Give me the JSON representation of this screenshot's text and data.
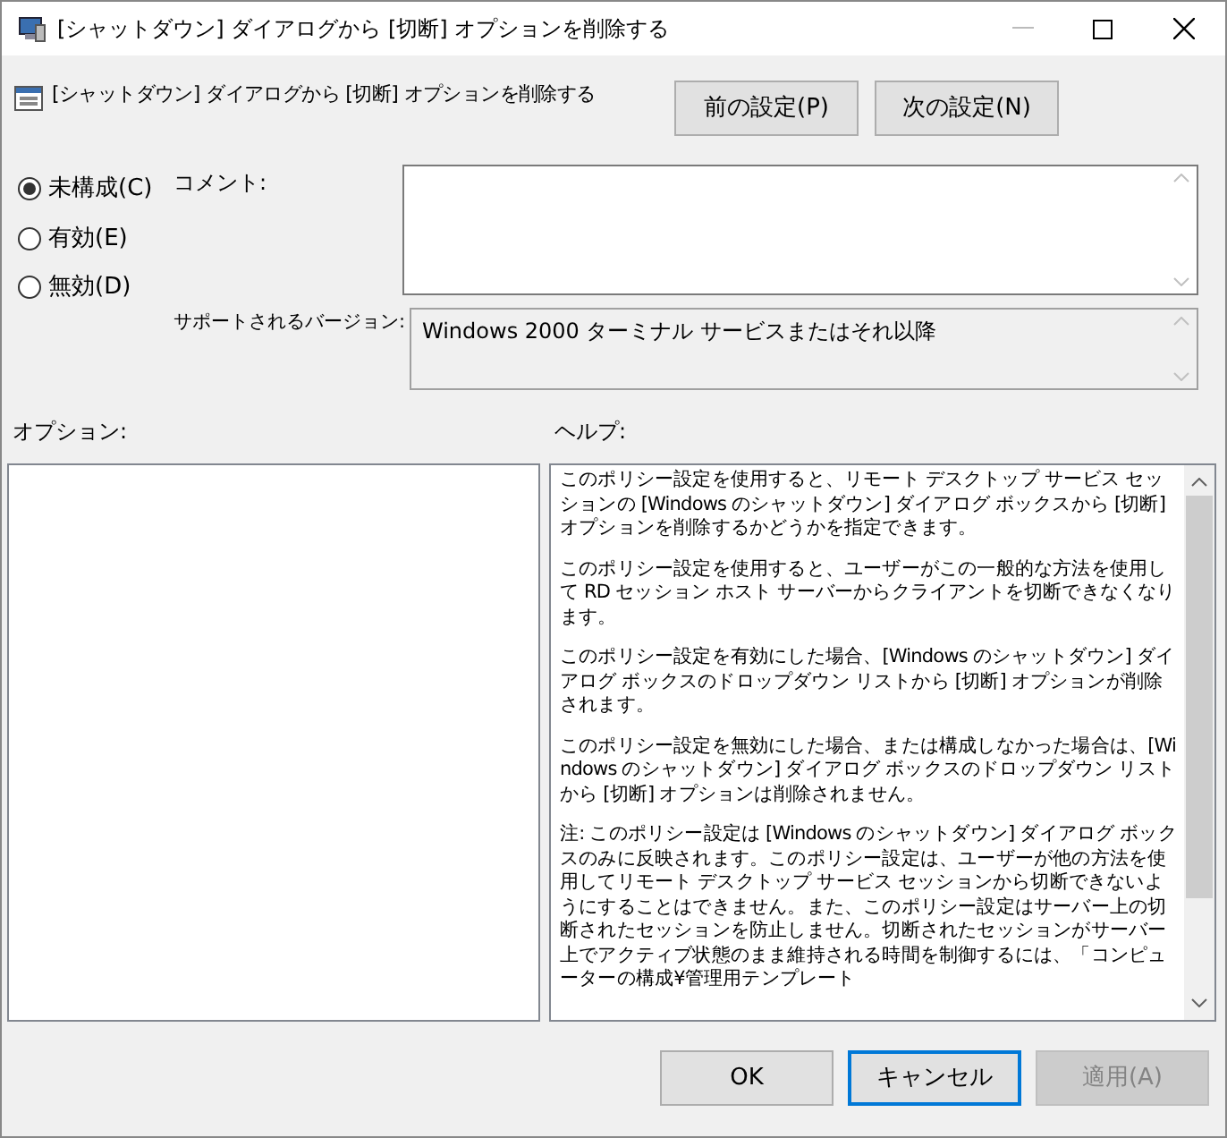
{
  "window": {
    "title": "[シャットダウン] ダイアログから [切断] オプションを削除する"
  },
  "header": {
    "title": "[シャットダウン] ダイアログから [切断] オプションを削除する",
    "buttons": [
      {
        "label": "前の設定(P)",
        "disabled": false
      },
      {
        "label": "次の設定(N)",
        "disabled": false
      }
    ]
  },
  "states": [
    {
      "label": "未構成(C)",
      "selected": true
    },
    {
      "label": "有効(E)",
      "selected": false
    },
    {
      "label": "無効(D)",
      "selected": false
    }
  ],
  "comment": {
    "label": "コメント:"
  },
  "supported": {
    "label": "サポートされるバージョン:",
    "value": "Windows 2000 ターミナル サービスまたはそれ以降"
  },
  "options": {
    "label": "オプション:"
  },
  "help": {
    "label": "ヘルプ:",
    "paragraphs": [
      "このポリシー設定を使用すると、リモート デスクトップ サービス セッションの [Windows のシャットダウン] ダイアログ ボックスから [切断] オプションを削除するかどうかを指定できます。",
      "このポリシー設定を使用すると、ユーザーがこの一般的な方法を使用して RD セッション ホスト サーバーからクライアントを切断できなくなります。",
      "このポリシー設定を有効にした場合、[Windows のシャットダウン] ダイアログ ボックスのドロップダウン リストから [切断] オプションが削除されます。",
      "このポリシー設定を無効にした場合、または構成しなかった場合は、[Windows のシャットダウン] ダイアログ ボックスのドロップダウン リストから [切断] オプションは削除されません。",
      "注: このポリシー設定は [Windows のシャットダウン] ダイアログ ボックスのみに反映されます。このポリシー設定は、ユーザーが他の方法を使用してリモート デスクトップ サービス セッションから切断できないようにすることはできません。また、このポリシー設定はサーバー上の切断されたセッションを防止しません。切断されたセッションがサーバー上でアクティブ状態のまま維持される時間を制御するには、「コンピューターの構成¥管理用テンプレート"
    ]
  },
  "footer": {
    "buttons": [
      {
        "label": "OK",
        "disabled": false,
        "focused": false
      },
      {
        "label": "キャンセル",
        "disabled": false,
        "focused": true
      },
      {
        "label": "適用(A)",
        "disabled": true,
        "focused": false
      }
    ]
  }
}
